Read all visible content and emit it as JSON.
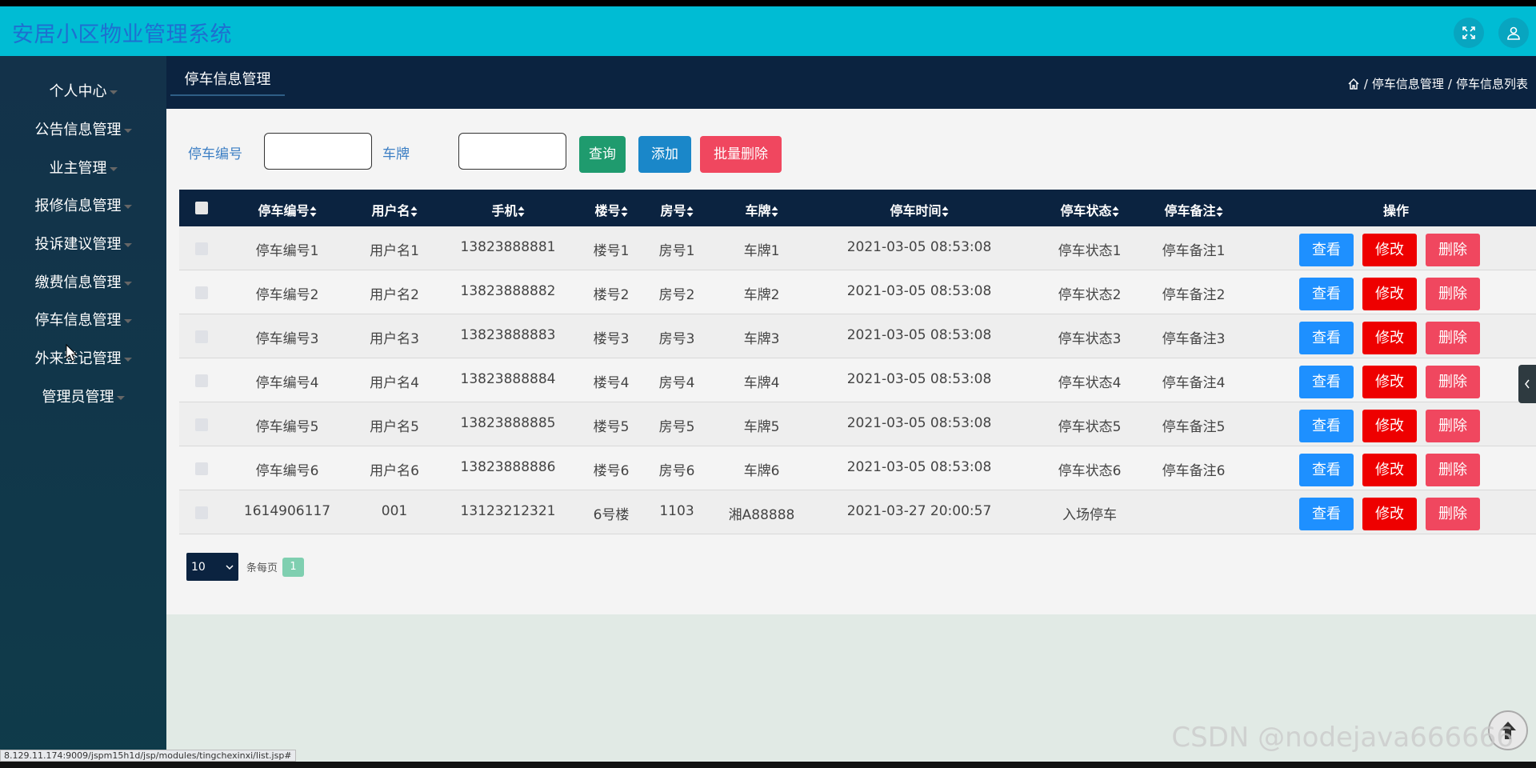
{
  "app": {
    "title": "安居小区物业管理系统"
  },
  "topbar": {
    "fullscreen_icon": "fullscreen-icon",
    "user_icon": "user-icon"
  },
  "sidebar": {
    "items": [
      {
        "label": "个人中心"
      },
      {
        "label": "公告信息管理"
      },
      {
        "label": "业主管理"
      },
      {
        "label": "报修信息管理"
      },
      {
        "label": "投诉建议管理"
      },
      {
        "label": "缴费信息管理"
      },
      {
        "label": "停车信息管理"
      },
      {
        "label": "外来登记管理"
      },
      {
        "label": "管理员管理"
      }
    ]
  },
  "navbar": {
    "tab": "停车信息管理",
    "breadcrumb": [
      "停车信息管理",
      "停车信息列表"
    ]
  },
  "search": {
    "field1_label": "停车编号",
    "field1_value": "",
    "field2_label": "车牌",
    "field2_value": "",
    "query_button": "查询",
    "add_button": "添加",
    "batch_delete_button": "批量删除"
  },
  "table": {
    "headers": [
      "停车编号",
      "用户名",
      "手机",
      "楼号",
      "房号",
      "车牌",
      "停车时间",
      "停车状态",
      "停车备注",
      "操作"
    ],
    "rows": [
      [
        "停车编号1",
        "用户名1",
        "13823888881",
        "楼号1",
        "房号1",
        "车牌1",
        "2021-03-05 08:53:08",
        "停车状态1",
        "停车备注1"
      ],
      [
        "停车编号2",
        "用户名2",
        "13823888882",
        "楼号2",
        "房号2",
        "车牌2",
        "2021-03-05 08:53:08",
        "停车状态2",
        "停车备注2"
      ],
      [
        "停车编号3",
        "用户名3",
        "13823888883",
        "楼号3",
        "房号3",
        "车牌3",
        "2021-03-05 08:53:08",
        "停车状态3",
        "停车备注3"
      ],
      [
        "停车编号4",
        "用户名4",
        "13823888884",
        "楼号4",
        "房号4",
        "车牌4",
        "2021-03-05 08:53:08",
        "停车状态4",
        "停车备注4"
      ],
      [
        "停车编号5",
        "用户名5",
        "13823888885",
        "楼号5",
        "房号5",
        "车牌5",
        "2021-03-05 08:53:08",
        "停车状态5",
        "停车备注5"
      ],
      [
        "停车编号6",
        "用户名6",
        "13823888886",
        "楼号6",
        "房号6",
        "车牌6",
        "2021-03-05 08:53:08",
        "停车状态6",
        "停车备注6"
      ],
      [
        "1614906117",
        "001",
        "13123212321",
        "6号楼",
        "1103",
        "湘A88888",
        "2021-03-27 20:00:57",
        "入场停车",
        ""
      ]
    ],
    "actions": {
      "view": "查看",
      "edit": "修改",
      "delete": "删除"
    }
  },
  "pagination": {
    "page_size": "10",
    "per_page_label": "条每页",
    "current_page": "1"
  },
  "status_bar": {
    "url": "8.129.11.174:9009/jspm15h1d/jsp/modules/tingchexinxi/list.jsp#"
  },
  "watermark": "CSDN @nodejava666666",
  "colors": {
    "topbar": "#00bcd4",
    "sidebar": "#13324a",
    "navbar": "#0b2340",
    "query_button": "#1f9b6e",
    "add_button": "#1a87c9",
    "batch_delete_button": "#f0475f",
    "view_button": "#1e90ff",
    "edit_button": "#ee0000",
    "delete_button": "#f0475f"
  }
}
